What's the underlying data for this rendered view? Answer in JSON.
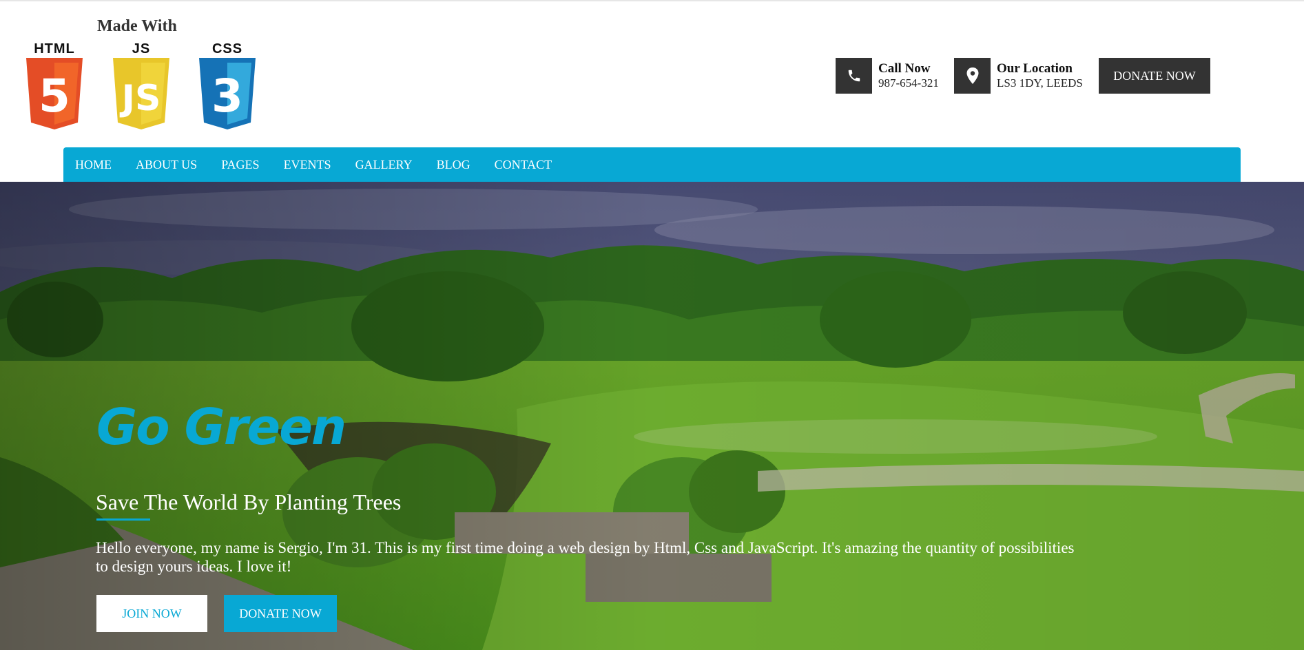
{
  "header": {
    "made_with": "Made With",
    "logos": [
      {
        "label": "HTML",
        "icon": "html5-shield-icon",
        "glyph": "5",
        "color": "#e44d26",
        "shade": "#f16529"
      },
      {
        "label": "JS",
        "icon": "js-shield-icon",
        "glyph": "JS",
        "color": "#e8c62a",
        "shade": "#f0d43a"
      },
      {
        "label": "CSS",
        "icon": "css3-shield-icon",
        "glyph": "3",
        "color": "#1572b6",
        "shade": "#33a9dc"
      }
    ],
    "contacts": {
      "phone": {
        "title": "Call Now",
        "value": "987-654-321",
        "icon": "phone-icon"
      },
      "location": {
        "title": "Our Location",
        "value": "LS3 1DY, LEEDS",
        "icon": "map-pin-icon"
      }
    },
    "donate_label": "DONATE NOW"
  },
  "nav": {
    "items": [
      "HOME",
      "ABOUT US",
      "PAGES",
      "EVENTS",
      "GALLERY",
      "BLOG",
      "CONTACT"
    ]
  },
  "hero": {
    "title": "Go Green",
    "subtitle": "Save The World By Planting Trees",
    "text": "Hello everyone, my name is Sergio, I'm 31. This is my first time doing a web design by Html, Css and JavaScript. It's amazing the quantity of possibilities to design yours ideas. I love it!",
    "join_label": "JOIN NOW",
    "donate_label": "DONATE NOW"
  },
  "colors": {
    "accent": "#08a8d4",
    "dark": "#333333"
  }
}
